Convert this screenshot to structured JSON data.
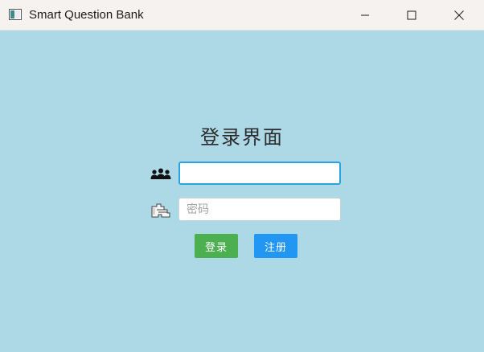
{
  "window": {
    "title": "Smart Question Bank",
    "background": "#add8e6"
  },
  "titlebar": {
    "icon": "app-window-icon",
    "controls": [
      "minimize-icon",
      "maximize-icon",
      "close-icon"
    ]
  },
  "form": {
    "heading": "登录界面",
    "username": {
      "icon": "users-icon",
      "value": "",
      "placeholder": ""
    },
    "password": {
      "icon": "lock-icon",
      "value": "",
      "placeholder": "密码"
    },
    "login_label": "登录",
    "register_label": "注册"
  },
  "colors": {
    "login_button": "#4caf50",
    "register_button": "#2196f3",
    "focus_border": "#2aa3e0"
  }
}
